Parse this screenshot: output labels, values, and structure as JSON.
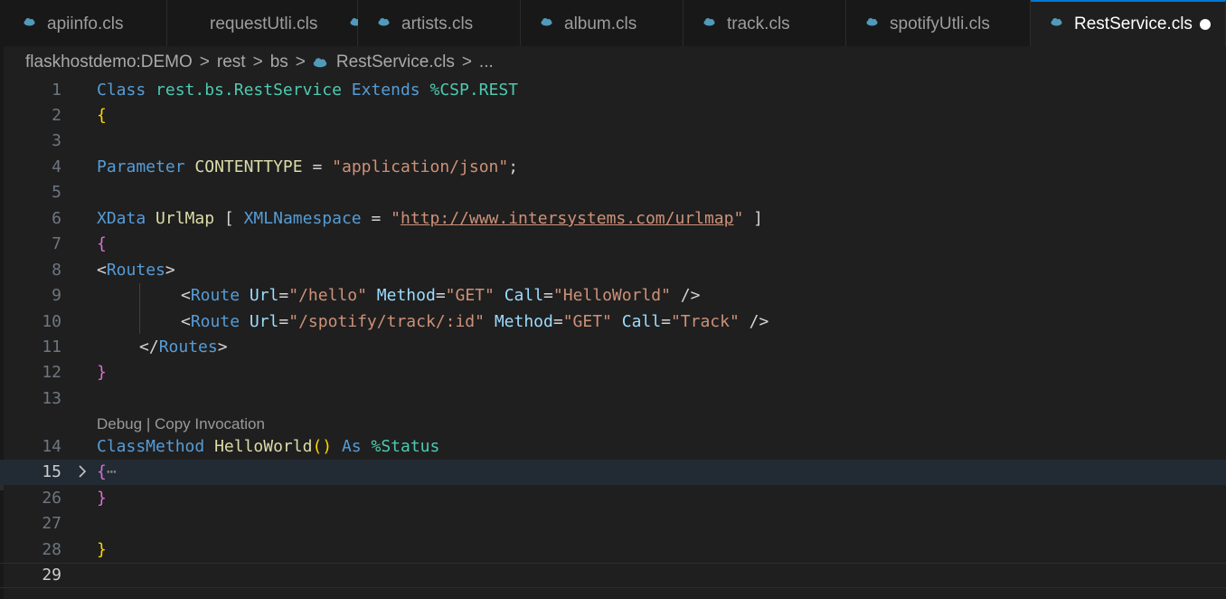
{
  "tabs": [
    {
      "label": "apiinfo.cls"
    },
    {
      "label": "requestUtli.cls"
    },
    {
      "label": "artists.cls"
    },
    {
      "label": "album.cls"
    },
    {
      "label": "track.cls"
    },
    {
      "label": "spotifyUtli.cls"
    },
    {
      "label": "RestService.cls",
      "active": true,
      "dirty": true
    }
  ],
  "breadcrumb": {
    "parts": [
      "flaskhostdemo:DEMO",
      "rest",
      "bs",
      "RestService.cls",
      "..."
    ],
    "separator": ">"
  },
  "codelens": {
    "debug": "Debug",
    "divider": "|",
    "copy": "Copy Invocation"
  },
  "line_numbers": [
    "1",
    "2",
    "3",
    "4",
    "5",
    "6",
    "7",
    "8",
    "9",
    "10",
    "11",
    "12",
    "13",
    "14",
    "15",
    "26",
    "27",
    "28",
    "29"
  ],
  "code": {
    "l1": [
      "Class",
      "rest.bs.RestService",
      "Extends",
      "%CSP.REST"
    ],
    "l2": [
      "{"
    ],
    "l4": [
      "Parameter",
      "CONTENTTYPE",
      "=",
      "\"application/json\"",
      ";"
    ],
    "l6": [
      "XData",
      "UrlMap",
      "[",
      "XMLNamespace",
      "=",
      "\"",
      "http://www.intersystems.com/urlmap",
      "\"",
      "]"
    ],
    "l7": [
      "{"
    ],
    "l8": [
      "<",
      "Routes",
      ">"
    ],
    "l9": [
      "<",
      "Route",
      "Url",
      "=",
      "\"/hello\"",
      "Method",
      "=",
      "\"GET\"",
      "Call",
      "=",
      "\"HelloWorld\"",
      "/>"
    ],
    "l10": [
      "<",
      "Route",
      "Url",
      "=",
      "\"/spotify/track/:id\"",
      "Method",
      "=",
      "\"GET\"",
      "Call",
      "=",
      "\"Track\"",
      "/>"
    ],
    "l11": [
      "</",
      "Routes",
      ">"
    ],
    "l12": [
      "}"
    ],
    "l14": [
      "ClassMethod",
      "HelloWorld",
      "()",
      "As",
      "%Status"
    ],
    "l15": [
      "{",
      "⋯"
    ],
    "l26": [
      "}"
    ],
    "l28": [
      "}"
    ]
  },
  "colors": {
    "accent": "#0078d4",
    "background": "#1f1f1f",
    "tab_bg": "#181818"
  }
}
